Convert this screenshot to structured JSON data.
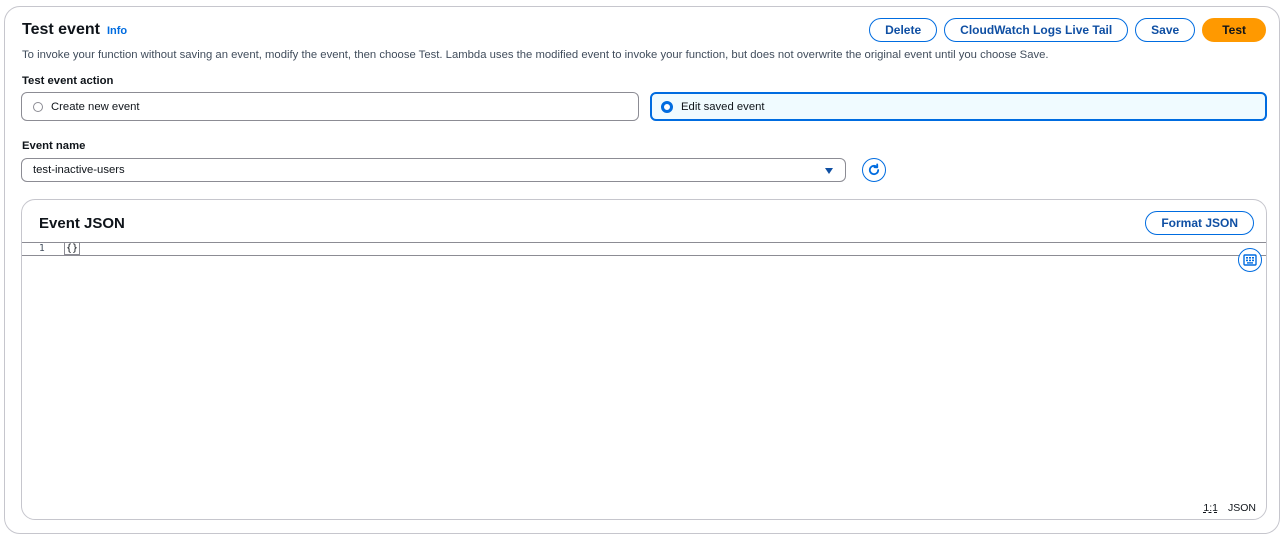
{
  "header": {
    "title": "Test event",
    "info_link": "Info",
    "description": "To invoke your function without saving an event, modify the event, then choose Test. Lambda uses the modified event to invoke your function, but does not overwrite the original event until you choose Save."
  },
  "actions": {
    "delete": "Delete",
    "live_tail": "CloudWatch Logs Live Tail",
    "save": "Save",
    "test": "Test"
  },
  "event_action": {
    "label": "Test event action",
    "options": [
      {
        "label": "Create new event",
        "selected": false
      },
      {
        "label": "Edit saved event",
        "selected": true
      }
    ]
  },
  "event_name": {
    "label": "Event name",
    "value": "test-inactive-users"
  },
  "editor": {
    "title": "Event JSON",
    "format_button": "Format JSON",
    "line_number": "1",
    "content": "{}",
    "cursor_position": "1:1",
    "language": "JSON"
  },
  "colors": {
    "accent": "#006ce0",
    "primary_button": "#ff9900"
  },
  "icons": [
    "caret-down-icon",
    "refresh-icon",
    "keyboard-icon"
  ]
}
